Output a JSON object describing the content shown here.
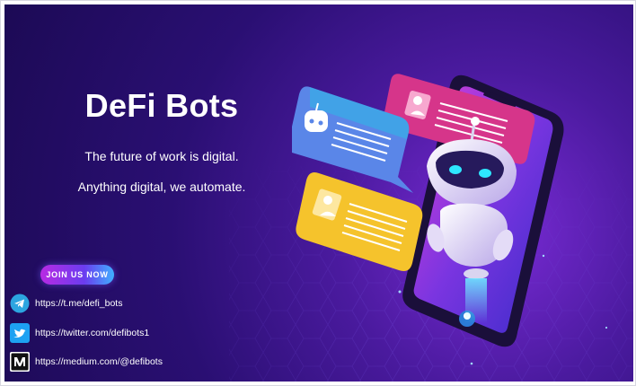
{
  "hero": {
    "title": "DeFi Bots",
    "tagline_1": "The future of work is digital.",
    "tagline_2": "Anything digital, we automate.",
    "join_label": "JOIN  US  NOW"
  },
  "links": [
    {
      "icon": "telegram-icon",
      "text": "https://t.me/defi_bots"
    },
    {
      "icon": "twitter-icon",
      "text": "https://twitter.com/defibots1"
    },
    {
      "icon": "medium-icon",
      "text": "https://medium.com/@defibots"
    }
  ],
  "colors": {
    "background": "#2a0f73",
    "accent_pink": "#d6358a",
    "accent_blue": "#5a86e8",
    "accent_yellow": "#f5c32c",
    "accent_cyan": "#23c6e6",
    "button_start": "#b82ae3",
    "button_end": "#3fb0ff"
  }
}
